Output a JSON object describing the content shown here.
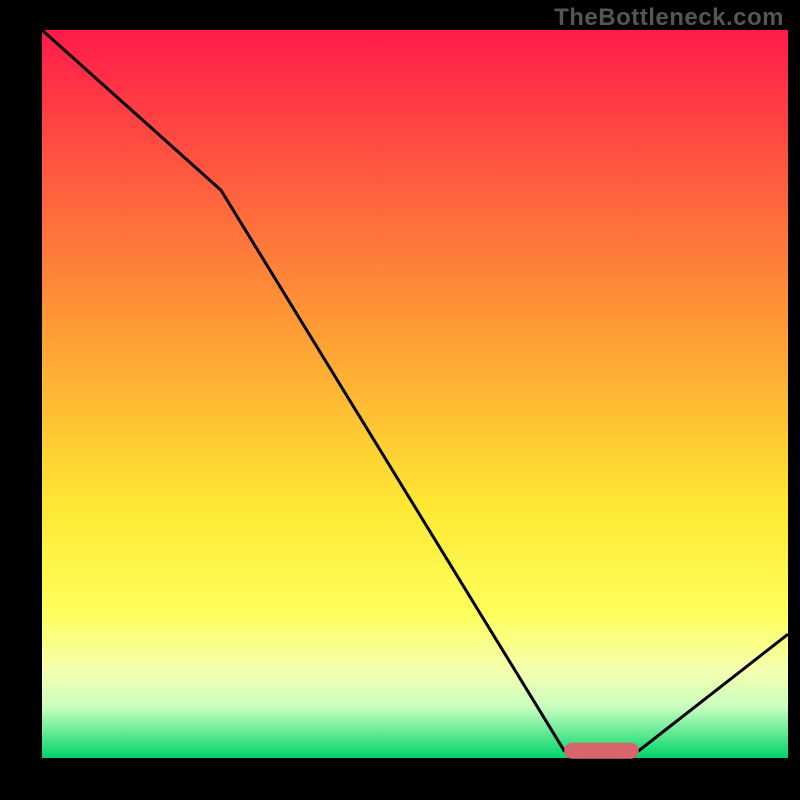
{
  "watermark": "TheBottleneck.com",
  "chart_data": {
    "type": "line",
    "title": "",
    "xlabel": "",
    "ylabel": "",
    "xlim": [
      0,
      100
    ],
    "ylim": [
      0,
      100
    ],
    "grid": false,
    "legend": false,
    "axes_visible": false,
    "background_gradient": {
      "stops": [
        {
          "pos": 0.0,
          "color": "#ff1a4a"
        },
        {
          "pos": 0.2,
          "color": "#ff5a3f"
        },
        {
          "pos": 0.45,
          "color": "#ffa834"
        },
        {
          "pos": 0.65,
          "color": "#ffe733"
        },
        {
          "pos": 0.8,
          "color": "#feff5a"
        },
        {
          "pos": 0.88,
          "color": "#f6ffb0"
        },
        {
          "pos": 0.93,
          "color": "#c9ffc0"
        },
        {
          "pos": 1.0,
          "color": "#00d46a"
        }
      ]
    },
    "series": [
      {
        "name": "bottleneck-curve",
        "color": "#000000",
        "x": [
          0,
          24,
          70,
          80,
          100
        ],
        "values": [
          100,
          78,
          1,
          1,
          17
        ]
      }
    ],
    "markers": [
      {
        "name": "optimal-range",
        "shape": "rounded-bar",
        "color": "#d9656b",
        "x_start": 70,
        "x_end": 80,
        "y": 1,
        "thickness_pct": 2.2
      }
    ]
  }
}
